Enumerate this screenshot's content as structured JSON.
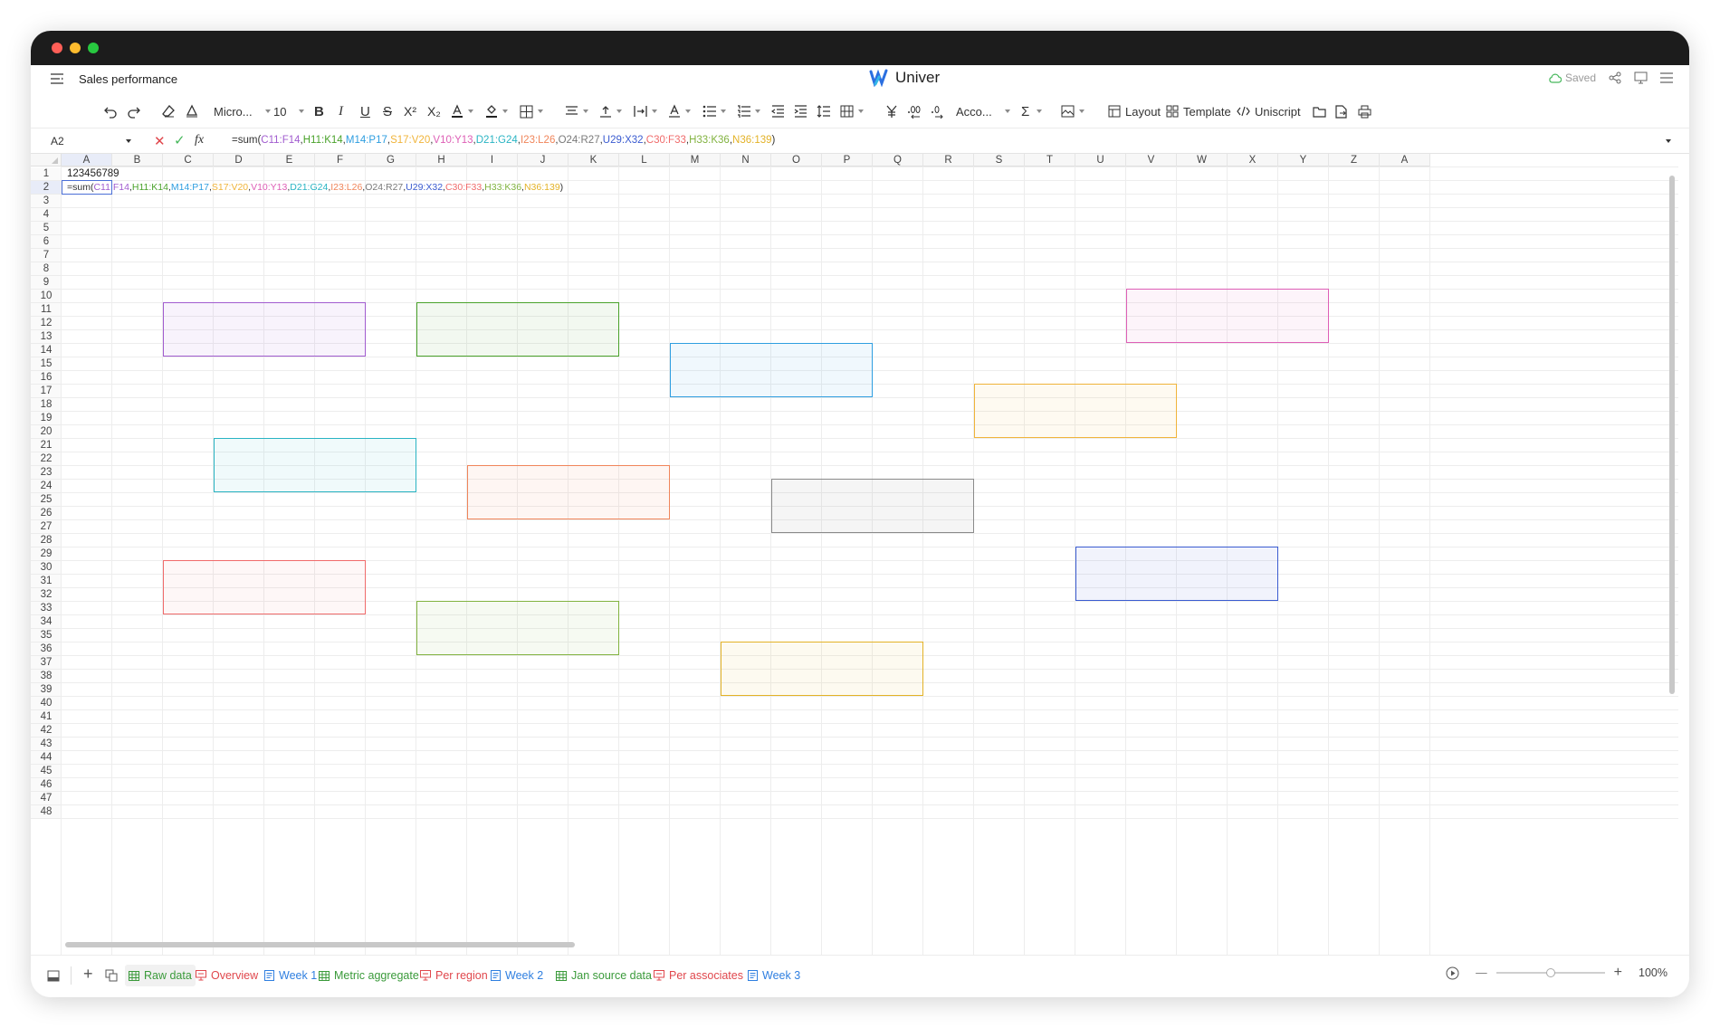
{
  "window": {
    "title": "Sales performance",
    "app_name": "Univer",
    "saved_label": "Saved"
  },
  "toolbar": {
    "font_name": "Micro...",
    "font_size": "10",
    "number_format": "Acco...",
    "layout_label": "Layout",
    "template_label": "Template",
    "uniscript_label": "Uniscript"
  },
  "formula_bar": {
    "cell_ref": "A2",
    "fx_label": "fx",
    "formula_parts": [
      {
        "text": "=sum(",
        "color": "#333333"
      },
      {
        "text": "C11:F14",
        "color": "#a15ccf"
      },
      {
        "text": ",",
        "color": "#333333"
      },
      {
        "text": "H11:K14",
        "color": "#4aa22b"
      },
      {
        "text": ",",
        "color": "#333333"
      },
      {
        "text": "M14:P17",
        "color": "#2e9ee0"
      },
      {
        "text": ",",
        "color": "#333333"
      },
      {
        "text": "S17:V20",
        "color": "#f0b43a"
      },
      {
        "text": ",",
        "color": "#333333"
      },
      {
        "text": "V10:Y13",
        "color": "#de5fb6"
      },
      {
        "text": ",",
        "color": "#333333"
      },
      {
        "text": "D21:G24",
        "color": "#29b4c3"
      },
      {
        "text": ",",
        "color": "#333333"
      },
      {
        "text": "I23:L26",
        "color": "#f0855a"
      },
      {
        "text": ",",
        "color": "#333333"
      },
      {
        "text": "O24:R27",
        "color": "#7a7a7a"
      },
      {
        "text": ",",
        "color": "#333333"
      },
      {
        "text": "U29:X32",
        "color": "#3a5bd0"
      },
      {
        "text": ",",
        "color": "#333333"
      },
      {
        "text": "C30:F33",
        "color": "#f06b6b"
      },
      {
        "text": ",",
        "color": "#333333"
      },
      {
        "text": "H33:K36",
        "color": "#82b340"
      },
      {
        "text": ",",
        "color": "#333333"
      },
      {
        "text": "N36:139",
        "color": "#e3b227"
      },
      {
        "text": ")",
        "color": "#333333"
      }
    ]
  },
  "sheet": {
    "columns": [
      "A",
      "B",
      "C",
      "D",
      "E",
      "F",
      "G",
      "H",
      "I",
      "J",
      "K",
      "L",
      "M",
      "N",
      "O",
      "P",
      "Q",
      "R",
      "S",
      "T",
      "U",
      "V",
      "W",
      "X",
      "Y",
      "Z",
      "A"
    ],
    "rows": [
      "1",
      "2",
      "3",
      "4",
      "5",
      "6",
      "7",
      "8",
      "9",
      "10",
      "11",
      "12",
      "13",
      "14",
      "15",
      "16",
      "17",
      "18",
      "19",
      "20",
      "21",
      "22",
      "23",
      "24",
      "25",
      "26",
      "27",
      "28",
      "29",
      "30",
      "31",
      "32",
      "33",
      "34",
      "35",
      "36",
      "37",
      "38",
      "39",
      "40",
      "41",
      "42",
      "43",
      "44",
      "45",
      "46",
      "47",
      "48"
    ],
    "cells": {
      "A1": "123456789"
    },
    "ranges": [
      {
        "name": "C11:F14",
        "color": "#a15ccf",
        "fill": "rgba(161,92,207,0.07)"
      },
      {
        "name": "H11:K14",
        "color": "#4aa22b",
        "fill": "rgba(74,162,43,0.07)"
      },
      {
        "name": "M14:P17",
        "color": "#2e9ee0",
        "fill": "rgba(46,158,224,0.07)"
      },
      {
        "name": "V10:Y13",
        "color": "#de5fb6",
        "fill": "rgba(222,95,182,0.07)"
      },
      {
        "name": "S17:V20",
        "color": "#f0b43a",
        "fill": "rgba(240,180,58,0.07)"
      },
      {
        "name": "D21:G24",
        "color": "#29b4c3",
        "fill": "rgba(41,180,195,0.07)"
      },
      {
        "name": "I23:L26",
        "color": "#f0855a",
        "fill": "rgba(240,133,90,0.07)"
      },
      {
        "name": "O24:R27",
        "color": "#8a8a8a",
        "fill": "rgba(120,120,120,0.07)"
      },
      {
        "name": "U29:X32",
        "color": "#3a5bd0",
        "fill": "rgba(58,91,208,0.07)"
      },
      {
        "name": "C30:F33",
        "color": "#f06b6b",
        "fill": "rgba(240,107,107,0.05)"
      },
      {
        "name": "H33:K36",
        "color": "#82b340",
        "fill": "rgba(130,179,64,0.07)"
      },
      {
        "name": "N36:Q39",
        "color": "#e3b227",
        "fill": "rgba(227,178,39,0.07)"
      }
    ]
  },
  "tabs": [
    {
      "label": "Raw data",
      "color": "#3a9a3a",
      "icon": "table-icon",
      "active": true
    },
    {
      "label": "Overview",
      "color": "#e0474c",
      "icon": "presentation-icon",
      "active": false
    },
    {
      "label": "Week 1",
      "color": "#2f7fe0",
      "icon": "doc-icon",
      "active": false
    },
    {
      "label": "Metric aggregate",
      "color": "#3a9a3a",
      "icon": "table-icon",
      "active": false
    },
    {
      "label": "Per region",
      "color": "#e0474c",
      "icon": "presentation-icon",
      "active": false
    },
    {
      "label": "Week 2",
      "color": "#2f7fe0",
      "icon": "doc-icon",
      "active": false
    },
    {
      "label": "Jan source data",
      "color": "#3a9a3a",
      "icon": "table-icon",
      "active": false
    },
    {
      "label": "Per associates",
      "color": "#e0474c",
      "icon": "presentation-icon",
      "active": false
    },
    {
      "label": "Week 3",
      "color": "#2f7fe0",
      "icon": "doc-icon",
      "active": false
    }
  ],
  "zoom": {
    "label": "100%",
    "level": 1.0
  }
}
